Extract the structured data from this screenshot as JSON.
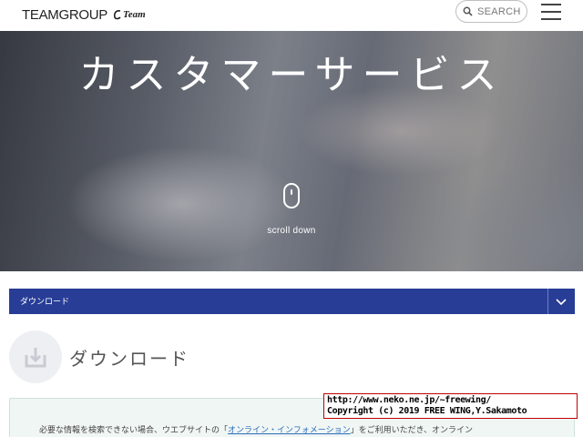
{
  "header": {
    "logo_text": "TEAMGROUP",
    "logo_badge": "Team",
    "search_label": "SEARCH"
  },
  "hero": {
    "title": "カスタマーサービス",
    "scroll_label": "scroll down"
  },
  "breadcrumb": {
    "label": "ダウンロード"
  },
  "section": {
    "title": "ダウンロード"
  },
  "notice": {
    "text_before": "必要な情報を検索できない場合、ウエブサイトの「",
    "link_text": "オンライン・インフォメーション",
    "text_after": "」をご利用いただき、オンライン"
  },
  "overlay": {
    "line1": "http://www.neko.ne.jp/~freewing/",
    "line2": "Copyright (c) 2019 FREE WING,Y.Sakamoto"
  },
  "colors": {
    "accent_blue": "#283d96",
    "link": "#2c6ebb",
    "notice_bg": "#f0f6f4"
  },
  "icons": [
    "search-icon",
    "hamburger-menu-icon",
    "mouse-scroll-icon",
    "chevron-down-icon",
    "download-tray-icon"
  ]
}
